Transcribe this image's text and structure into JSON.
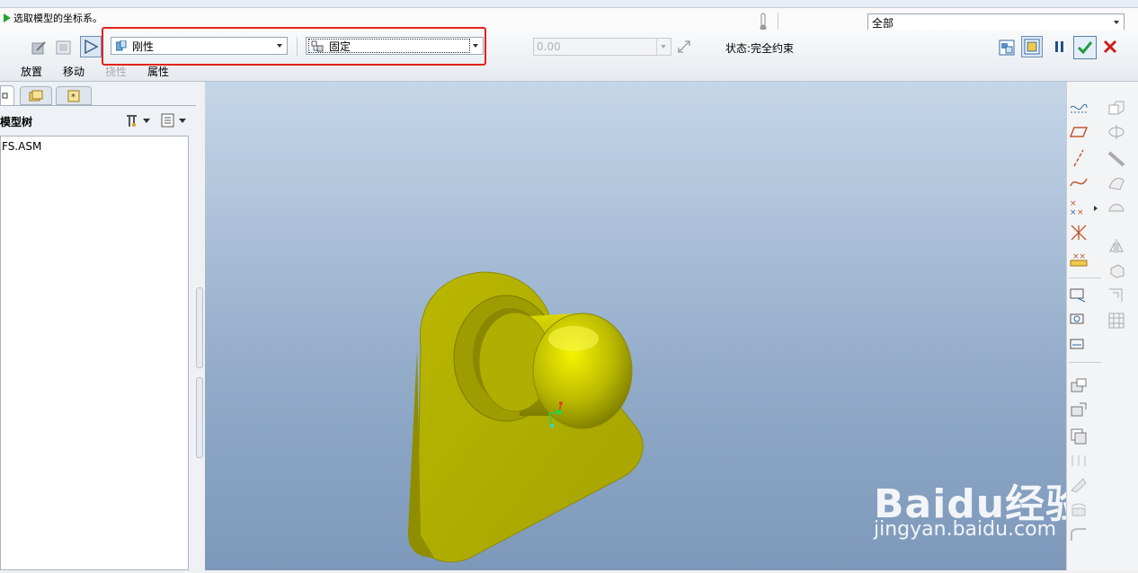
{
  "prompt": {
    "text": "选取模型的坐标系。"
  },
  "filter": {
    "selected": "全部"
  },
  "dashboard": {
    "constraint_type": "刚性",
    "constraint_sub": "固定",
    "offset_value": "0.00",
    "status": "状态:完全约束",
    "tabs": [
      "放置",
      "移动",
      "挠性",
      "属性"
    ]
  },
  "model_tree": {
    "title": "模型树",
    "items": [
      "FS.ASM"
    ]
  },
  "watermark": {
    "brand": "Baidu经验",
    "url": "jingyan.baidu.com"
  },
  "colors": {
    "highlight": "#e2231a",
    "part": "#b5b300",
    "accept": "#1f9d3a",
    "cancel": "#d21b1b"
  }
}
